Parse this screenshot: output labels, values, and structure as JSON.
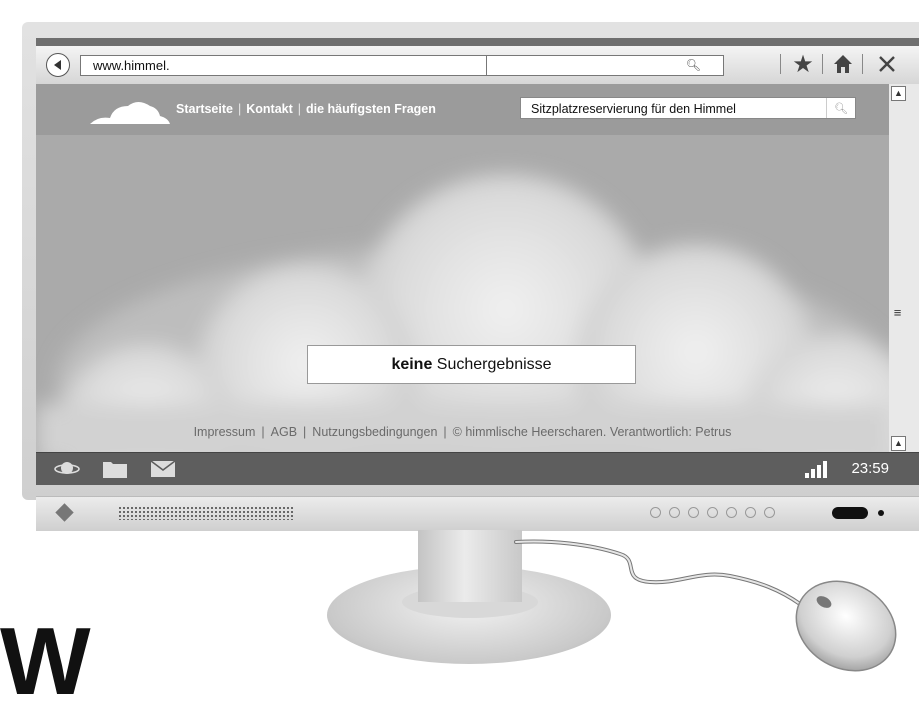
{
  "browser": {
    "url": "www.himmel.",
    "search_value": ""
  },
  "site": {
    "nav": [
      {
        "label": "Startseite"
      },
      {
        "label": "Kontakt"
      },
      {
        "label": "die häufigsten Fragen"
      }
    ],
    "search_value": "Sitzplatzreservierung für den Himmel",
    "result": {
      "bold": "keine",
      "rest": " Suchergebnisse"
    },
    "footer": [
      {
        "label": "Impressum"
      },
      {
        "label": "AGB"
      },
      {
        "label": "Nutzungsbedingungen"
      },
      {
        "label": "© himmlische Heerscharen. Verantwortlich: Petrus"
      }
    ]
  },
  "taskbar": {
    "clock": "23:59",
    "icons": [
      "planet-icon",
      "folder-icon",
      "mail-icon"
    ]
  },
  "overlay_letter": "W",
  "colors": {
    "viewport": "#aaaaaa",
    "header": "#9b9b9b",
    "taskbar": "#5e5e5e"
  }
}
